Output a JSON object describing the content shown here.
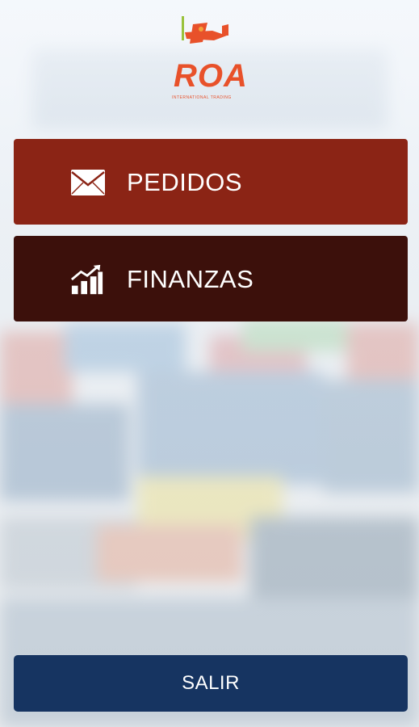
{
  "logo": {
    "text": "ROA",
    "subtitle": "INTERNATIONAL TRADING",
    "color": "#e8512a"
  },
  "menu": {
    "items": [
      {
        "label": "PEDIDOS",
        "icon": "envelope-icon",
        "color": "#8b2415"
      },
      {
        "label": "FINANZAS",
        "icon": "growth-chart-icon",
        "color": "#3c100b"
      }
    ]
  },
  "footer": {
    "exit_label": "SALIR",
    "exit_color": "#163461"
  }
}
